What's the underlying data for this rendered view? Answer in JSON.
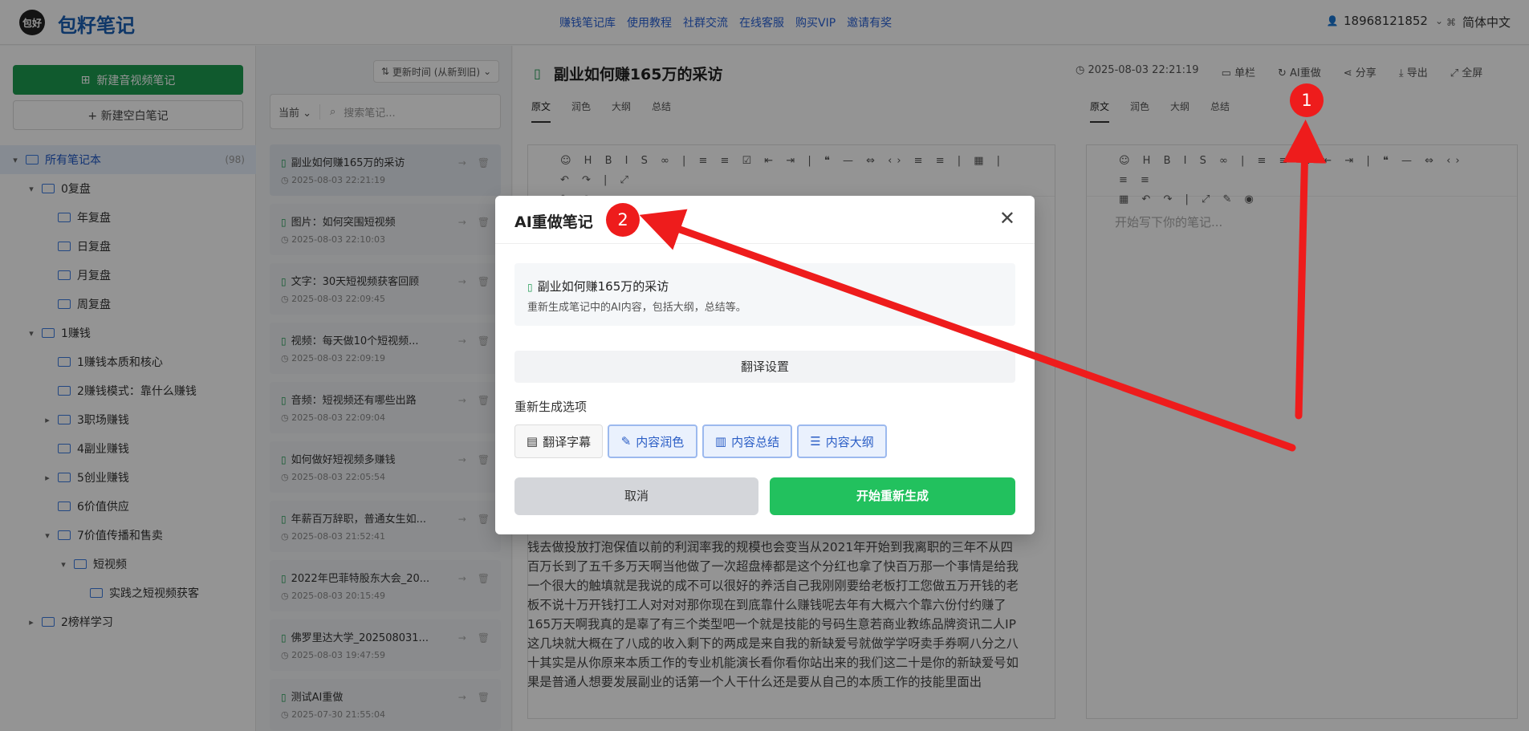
{
  "header": {
    "logo_text": "包好",
    "brand": "包籽笔记",
    "nav": [
      "赚钱笔记库",
      "使用教程",
      "社群交流",
      "在线客服",
      "购买VIP",
      "邀请有奖"
    ],
    "user": "18968121852",
    "lang": "简体中文"
  },
  "sidebar": {
    "new_av_note": "新建音视频笔记",
    "new_blank_note": "+ 新建空白笔记",
    "tree": [
      {
        "label": "所有笔记本",
        "count": "(98)",
        "level": 0,
        "caret": "▾",
        "active": true
      },
      {
        "label": "0复盘",
        "level": 1,
        "caret": "▾"
      },
      {
        "label": "年复盘",
        "level": 2,
        "caret": ""
      },
      {
        "label": "日复盘",
        "level": 2,
        "caret": ""
      },
      {
        "label": "月复盘",
        "level": 2,
        "caret": ""
      },
      {
        "label": "周复盘",
        "level": 2,
        "caret": ""
      },
      {
        "label": "1赚钱",
        "level": 1,
        "caret": "▾"
      },
      {
        "label": "1赚钱本质和核心",
        "level": 2,
        "caret": ""
      },
      {
        "label": "2赚钱模式：靠什么赚钱",
        "level": 2,
        "caret": ""
      },
      {
        "label": "3职场赚钱",
        "level": 2,
        "caret": "▸"
      },
      {
        "label": "4副业赚钱",
        "level": 2,
        "caret": ""
      },
      {
        "label": "5创业赚钱",
        "level": 2,
        "caret": "▸"
      },
      {
        "label": "6价值供应",
        "level": 2,
        "caret": ""
      },
      {
        "label": "7价值传播和售卖",
        "level": 2,
        "caret": "▾"
      },
      {
        "label": "短视频",
        "level": 3,
        "caret": "▾"
      },
      {
        "label": "实践之短视频获客",
        "level": 4,
        "caret": ""
      },
      {
        "label": "2榜样学习",
        "level": 1,
        "caret": "▸"
      }
    ]
  },
  "notes_list": {
    "sort_label": "更新时间 (从新到旧)",
    "scope": "当前",
    "search_placeholder": "搜索笔记...",
    "items": [
      {
        "title": "副业如何赚165万的采访",
        "date": "2025-08-03 22:21:19"
      },
      {
        "title": "图片：如何突围短视频",
        "date": "2025-08-03 22:10:03"
      },
      {
        "title": "文字：30天短视频获客回顾",
        "date": "2025-08-03 22:09:45"
      },
      {
        "title": "视频：每天做10个短视频...",
        "date": "2025-08-03 22:09:19"
      },
      {
        "title": "音频：短视频还有哪些出路",
        "date": "2025-08-03 22:09:04"
      },
      {
        "title": "如何做好短视频多赚钱",
        "date": "2025-08-03 22:05:54"
      },
      {
        "title": "年薪百万辞职，普通女生如...",
        "date": "2025-08-03 21:52:41"
      },
      {
        "title": "2022年巴菲特股东大会_20...",
        "date": "2025-08-03 20:15:49"
      },
      {
        "title": "佛罗里达大学_202508031...",
        "date": "2025-08-03 19:47:59"
      },
      {
        "title": "测试AI重做",
        "date": "2025-07-30 21:55:04"
      }
    ]
  },
  "editor": {
    "title": "副业如何赚165万的采访",
    "updated": "2025-08-03 22:21:19",
    "actions": [
      "单栏",
      "AI重做",
      "分享",
      "导出",
      "全屏"
    ],
    "tabs": [
      "原文",
      "润色",
      "大纲",
      "总结"
    ],
    "placeholder": "开始写下你的笔记...",
    "body": "钱去做投放打泡保值以前的利润率我的规模也会变当从2021年开始到我离职的三年不从四百万长到了五千多万天啊当他做了一次超盘棒都是这个分红也拿了快百万那一个事情是给我一个很大的触填就是我说的成不可以很好的养活自己我刚刚要给老板打工您做五万开钱的老板不说十万开钱打工人对对对那你现在到底靠什么赚钱呢去年有大概六个靠六份付约赚了165万天啊我真的是辜了有三个类型吧一个就是技能的号码生意若商业教练品牌资讯二人IP这几块就大概在了八成的收入剩下的两成是来自我的新缺爱号就做学学呀卖手券啊八分之八十其实是从你原来本质工作的专业机能演长看你看你站出来的我们这二十是你的新缺爱号如果是普通人想要发展副业的话第一个人干什么还是要从自己的本质工作的技能里面出"
  },
  "modal": {
    "title": "AI重做笔记",
    "note_title": "副业如何赚165万的采访",
    "note_desc": "重新生成笔记中的AI内容，包括大纲，总结等。",
    "translate_settings": "翻译设置",
    "options_label": "重新生成选项",
    "options": [
      {
        "label": "翻译字幕",
        "icon": "▤",
        "selected": false
      },
      {
        "label": "内容润色",
        "icon": "✎",
        "selected": true
      },
      {
        "label": "内容总结",
        "icon": "▥",
        "selected": true
      },
      {
        "label": "内容大纲",
        "icon": "☰",
        "selected": true
      }
    ],
    "cancel": "取消",
    "start": "开始重新生成"
  },
  "annotations": {
    "badge_1": "1",
    "badge_2": "2",
    "color": "#ee1c1c"
  }
}
